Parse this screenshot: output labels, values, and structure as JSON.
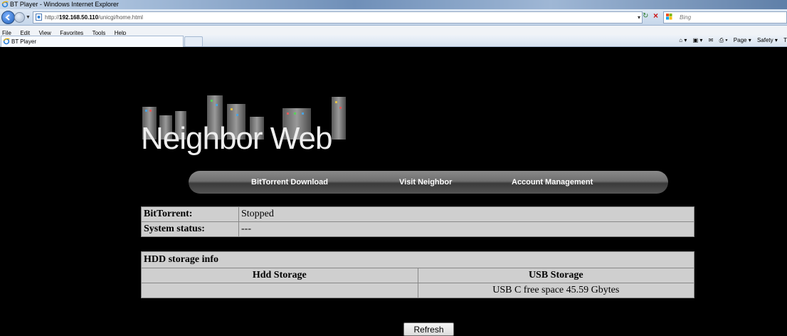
{
  "browser": {
    "window_title": "BT Player - Windows Internet Explorer",
    "url_prefix": "http://",
    "url_host": "192.168.50.110",
    "url_path": "/unicgi/home.html",
    "search_placeholder": "Bing",
    "menu": [
      "File",
      "Edit",
      "View",
      "Favorites",
      "Tools",
      "Help"
    ],
    "tab_title": "BT Player",
    "command_bar": [
      "Page ▾",
      "Safety ▾",
      "T"
    ]
  },
  "page": {
    "logo_text": "Neighbor Web",
    "nav": {
      "bittorrent_download": "BitTorrent Download",
      "visit_neighbor": "Visit Neighbor",
      "account_management": "Account Management"
    },
    "status": {
      "bittorrent_label": "BitTorrent:",
      "bittorrent_value": "Stopped",
      "system_label": "System status:",
      "system_value": "---"
    },
    "hdd": {
      "caption": "HDD storage info",
      "col_hdd": "Hdd Storage",
      "col_usb": "USB Storage",
      "hdd_value": "",
      "usb_value": "USB C free space 45.59 Gbytes"
    },
    "refresh_label": "Refresh"
  },
  "colors": {
    "page_background": "#000000",
    "table_background": "#cfcfcf",
    "nav_strip": "#6e6e6e"
  }
}
